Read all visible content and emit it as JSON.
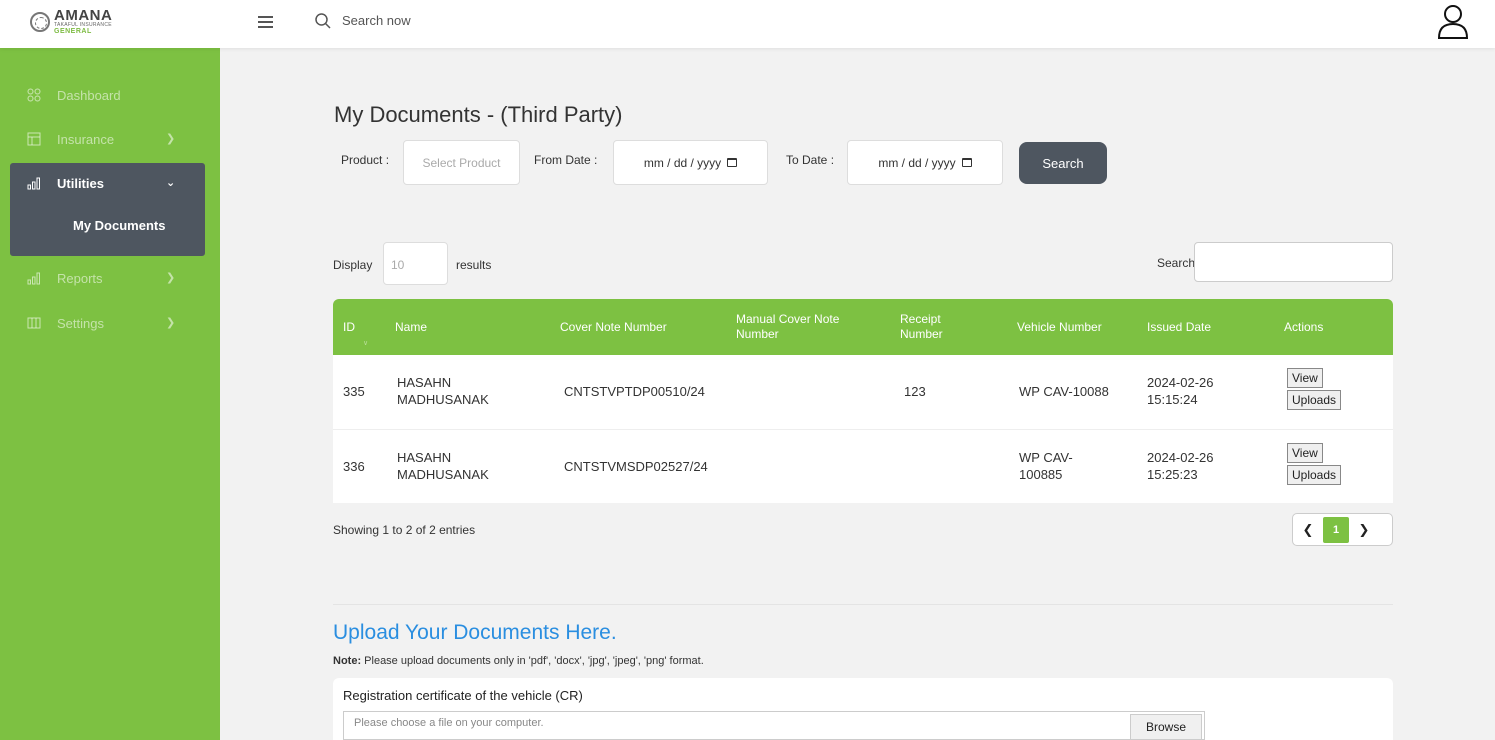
{
  "header": {
    "logo_main": "AMANA",
    "logo_sub": "TAKAFUL INSURANCE",
    "logo_general": "GENERAL",
    "search_placeholder": "Search now"
  },
  "sidebar": {
    "items": [
      {
        "label": "Dashboard",
        "icon": "dashboard-icon"
      },
      {
        "label": "Insurance",
        "icon": "insurance-icon"
      },
      {
        "label": "Utilities",
        "icon": "utilities-icon"
      },
      {
        "label": "Reports",
        "icon": "reports-icon"
      },
      {
        "label": "Settings",
        "icon": "settings-icon"
      }
    ],
    "sub_item": "My Documents"
  },
  "page": {
    "title": "My Documents - (Third Party)"
  },
  "filters": {
    "product_label": "Product :",
    "product_placeholder": "Select Product",
    "from_label": "From Date :",
    "from_value": "mm / dd / yyyy",
    "to_label": "To Date :",
    "to_value": "mm / dd / yyyy",
    "search_button": "Search"
  },
  "table_controls": {
    "display_label": "Display",
    "display_placeholder": "10",
    "results_label": "results",
    "search_label": "Search:"
  },
  "table": {
    "headers": [
      "ID",
      "Name",
      "Cover Note Number",
      "Manual Cover Note Number",
      "Receipt Number",
      "Vehicle Number",
      "Issued Date",
      "Actions"
    ],
    "rows": [
      {
        "id": "335",
        "name": "HASAHN MADHUSANAK",
        "cover_note": "CNTSTVPTDP00510/24",
        "manual_cover_note": "",
        "receipt": "123",
        "vehicle": "WP CAV-10088",
        "issued": "2024-02-26 15:15:24",
        "view": "View",
        "uploads": "Uploads"
      },
      {
        "id": "336",
        "name": "HASAHN MADHUSANAK",
        "cover_note": "CNTSTVMSDP02527/24",
        "manual_cover_note": "",
        "receipt": "",
        "vehicle": "WP CAV-100885",
        "issued": "2024-02-26 15:25:23",
        "view": "View",
        "uploads": "Uploads"
      }
    ]
  },
  "pagination": {
    "showing": "Showing 1 to 2 of 2 entries",
    "current_page": "1"
  },
  "upload": {
    "title": "Upload Your Documents Here.",
    "note_label": "Note:",
    "note_text": " Please upload documents only in 'pdf', 'docx', 'jpg', 'jpeg', 'png' format.",
    "field_label": "Registration certificate of the vehicle (CR)",
    "file_placeholder": "Please choose a file on your computer.",
    "browse": "Browse"
  },
  "colors": {
    "brand_green": "#7dc142",
    "active_nav": "#4e5660",
    "link_blue": "#2a8ee0"
  }
}
